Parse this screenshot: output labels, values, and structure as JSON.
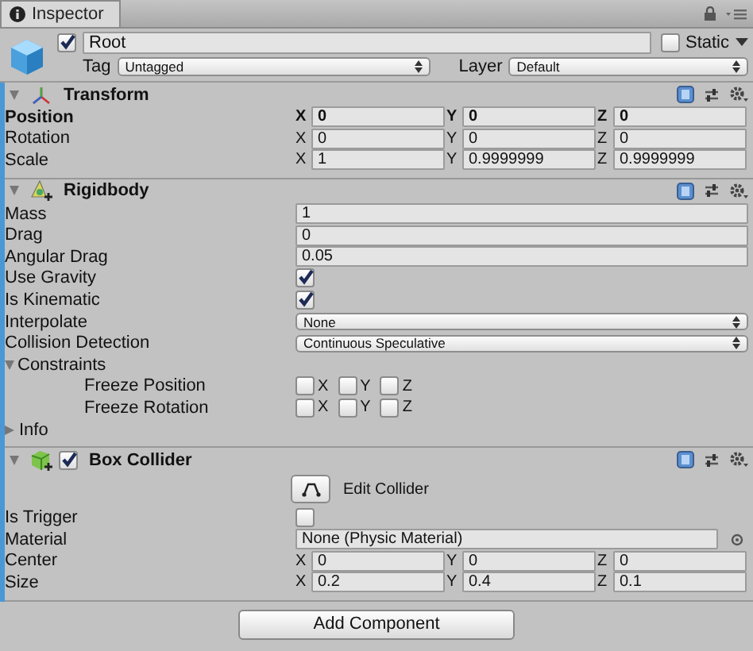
{
  "tab": {
    "label": "Inspector",
    "selected": true
  },
  "object": {
    "active": true,
    "name": "Root",
    "static": {
      "label": "Static",
      "checked": false
    },
    "tag": {
      "label": "Tag",
      "value": "Untagged"
    },
    "layer": {
      "label": "Layer",
      "value": "Default"
    }
  },
  "components": [
    {
      "title": "Transform",
      "kind": "transform",
      "expanded": true,
      "rows": [
        {
          "kind": "vector",
          "label": "Position",
          "bold": true,
          "axes": [
            {
              "axis": "X",
              "value": "0"
            },
            {
              "axis": "Y",
              "value": "0"
            },
            {
              "axis": "Z",
              "value": "0"
            }
          ]
        },
        {
          "kind": "vector",
          "label": "Rotation",
          "bold": false,
          "axes": [
            {
              "axis": "X",
              "value": "0"
            },
            {
              "axis": "Y",
              "value": "0"
            },
            {
              "axis": "Z",
              "value": "0"
            }
          ]
        },
        {
          "kind": "vector",
          "label": "Scale",
          "bold": false,
          "axes": [
            {
              "axis": "X",
              "value": "1"
            },
            {
              "axis": "Y",
              "value": "0.9999999"
            },
            {
              "axis": "Z",
              "value": "0.9999999"
            }
          ]
        }
      ]
    },
    {
      "title": "Rigidbody",
      "kind": "rigidbody",
      "expanded": true,
      "rows": [
        {
          "kind": "number",
          "label": "Mass",
          "value": "1"
        },
        {
          "kind": "number",
          "label": "Drag",
          "value": "0"
        },
        {
          "kind": "number",
          "label": "Angular Drag",
          "value": "0.05"
        },
        {
          "kind": "checkbox",
          "label": "Use Gravity",
          "checked": true
        },
        {
          "kind": "checkbox",
          "label": "Is Kinematic",
          "checked": true
        },
        {
          "kind": "dropdown",
          "label": "Interpolate",
          "value": "None"
        },
        {
          "kind": "dropdown",
          "label": "Collision Detection",
          "value": "Continuous Speculative"
        },
        {
          "kind": "foldout",
          "label": "Constraints",
          "expanded": true,
          "children": [
            {
              "kind": "flags",
              "label": "Freeze Position",
              "flags": [
                {
                  "axis": "X",
                  "checked": false
                },
                {
                  "axis": "Y",
                  "checked": false
                },
                {
                  "axis": "Z",
                  "checked": false
                }
              ]
            },
            {
              "kind": "flags",
              "label": "Freeze Rotation",
              "flags": [
                {
                  "axis": "X",
                  "checked": false
                },
                {
                  "axis": "Y",
                  "checked": false
                },
                {
                  "axis": "Z",
                  "checked": false
                }
              ]
            }
          ]
        },
        {
          "kind": "foldout",
          "label": "Info",
          "expanded": false
        }
      ]
    },
    {
      "title": "Box Collider",
      "kind": "collider",
      "expanded": true,
      "enabled": true,
      "rows": [
        {
          "kind": "edit_button",
          "label": "Edit Collider"
        },
        {
          "kind": "checkbox",
          "label": "Is Trigger",
          "checked": false
        },
        {
          "kind": "object",
          "label": "Material",
          "value": "None (Physic Material)"
        },
        {
          "kind": "vector",
          "label": "Center",
          "bold": false,
          "axes": [
            {
              "axis": "X",
              "value": "0"
            },
            {
              "axis": "Y",
              "value": "0"
            },
            {
              "axis": "Z",
              "value": "0"
            }
          ]
        },
        {
          "kind": "vector",
          "label": "Size",
          "bold": false,
          "axes": [
            {
              "axis": "X",
              "value": "0.2"
            },
            {
              "axis": "Y",
              "value": "0.4"
            },
            {
              "axis": "Z",
              "value": "0.1"
            }
          ]
        }
      ]
    }
  ],
  "add_button": "Add Component"
}
